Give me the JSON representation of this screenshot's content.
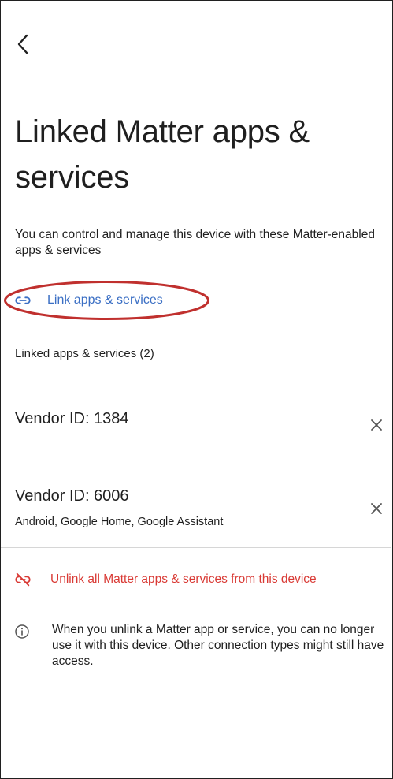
{
  "header": {
    "back_icon": "chevron-left-icon"
  },
  "page": {
    "title": "Linked Matter apps & services",
    "description": "You can control and manage this device with these Matter-enabled apps & services"
  },
  "link_action": {
    "label": "Link apps & services",
    "icon": "link-icon",
    "color": "#3b6fc4",
    "highlight_color": "#c0302e"
  },
  "linked_section": {
    "heading": "Linked apps & services (2)",
    "items": [
      {
        "title": "Vendor ID: 1384",
        "subtitle": ""
      },
      {
        "title": "Vendor ID: 6006",
        "subtitle": "Android, Google Home, Google Assistant"
      }
    ]
  },
  "unlink_action": {
    "label": "Unlink all Matter apps & services from this device",
    "icon": "link-off-icon",
    "color": "#d93a35"
  },
  "info": {
    "icon": "info-icon",
    "text": "When you unlink a Matter app or service, you can no longer use it with this device. Other connection types might still have access."
  }
}
